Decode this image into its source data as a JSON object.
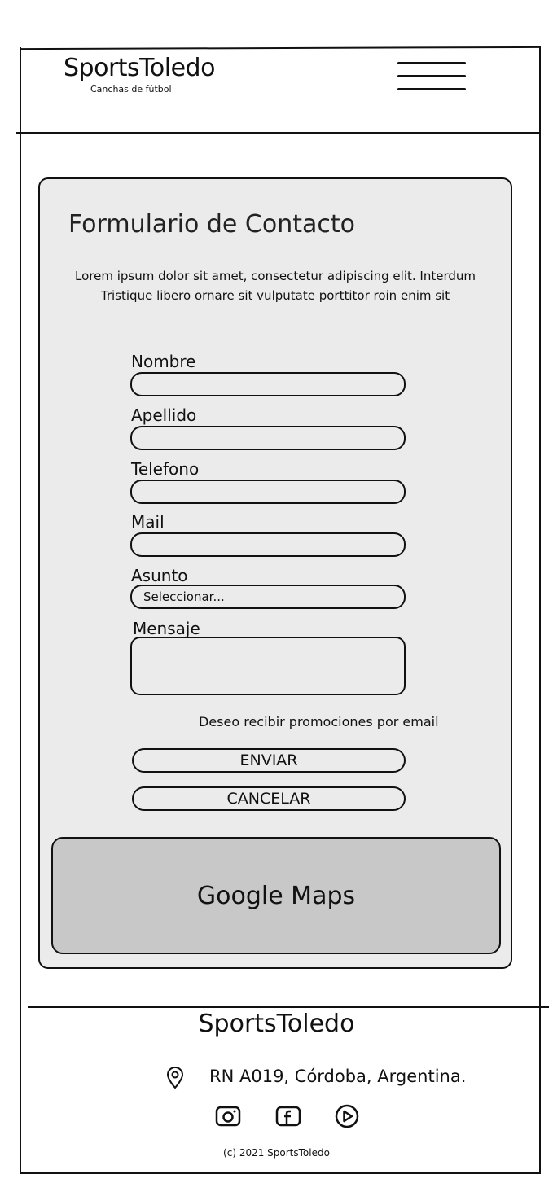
{
  "header": {
    "brand": "SportsToledo",
    "tagline": "Canchas de fútbol",
    "menu_icon": "hamburger-menu-icon"
  },
  "contact_form": {
    "title": "Formulario de Contacto",
    "intro_line1": "Lorem ipsum dolor sit amet, consectetur adipiscing elit. Interdum",
    "intro_line2": "Tristique libero ornare sit vulputate porttitor roin enim sit",
    "fields": {
      "nombre_label": "Nombre",
      "apellido_label": "Apellido",
      "telefono_label": "Telefono",
      "mail_label": "Mail",
      "asunto_label": "Asunto",
      "asunto_value": "Seleccionar...",
      "mensaje_label": "Mensaje"
    },
    "promo_label": "Deseo recibir promociones por email",
    "submit_label": "ENVIAR",
    "cancel_label": "CANCELAR"
  },
  "map": {
    "label": "Google Maps"
  },
  "footer": {
    "brand": "SportsToledo",
    "address": "RN A019, Córdoba, Argentina.",
    "location_icon": "location-pin-icon",
    "social_icons": [
      "instagram-icon",
      "facebook-icon",
      "youtube-icon"
    ],
    "copyright": "(c) 2021 SportsToledo"
  }
}
